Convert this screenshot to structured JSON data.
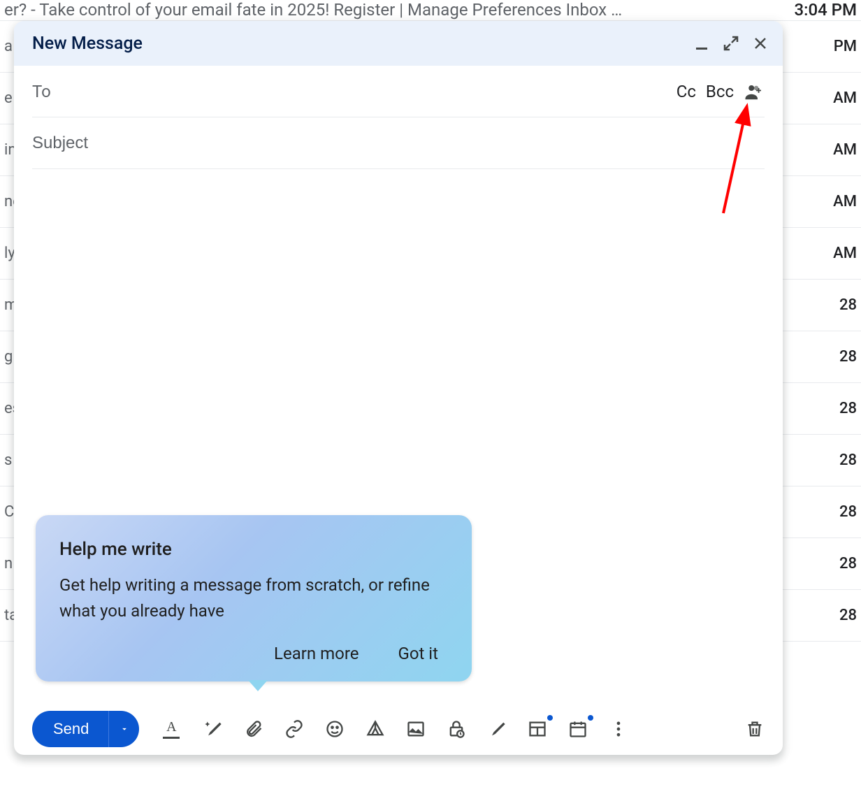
{
  "background": {
    "first_row_left": "er? - Take control of your email fate in 2025! Register | Manage Preferences Inbox …",
    "first_row_right": "3:04 PM",
    "rows": [
      {
        "left": "a",
        "right": "PM"
      },
      {
        "left": "e",
        "right": "AM"
      },
      {
        "left": "in",
        "right": "AM"
      },
      {
        "left": "ne",
        "right": "AM"
      },
      {
        "left": "ly",
        "right": "AM"
      },
      {
        "left": "m",
        "right": "28"
      },
      {
        "left": "g",
        "right": "28"
      },
      {
        "left": "es",
        "right": "28"
      },
      {
        "left": "s",
        "right": "28"
      },
      {
        "left": "C",
        "right": "28"
      },
      {
        "left": "n",
        "right": "28"
      },
      {
        "left": "ta",
        "right": "28"
      }
    ]
  },
  "compose": {
    "title": "New Message",
    "to_label": "To",
    "cc_label": "Cc",
    "bcc_label": "Bcc",
    "subject_placeholder": "Subject"
  },
  "promo": {
    "title": "Help me write",
    "text": "Get help writing a message from scratch, or refine what you already have",
    "learn_more": "Learn more",
    "got_it": "Got it"
  },
  "toolbar": {
    "send": "Send"
  }
}
